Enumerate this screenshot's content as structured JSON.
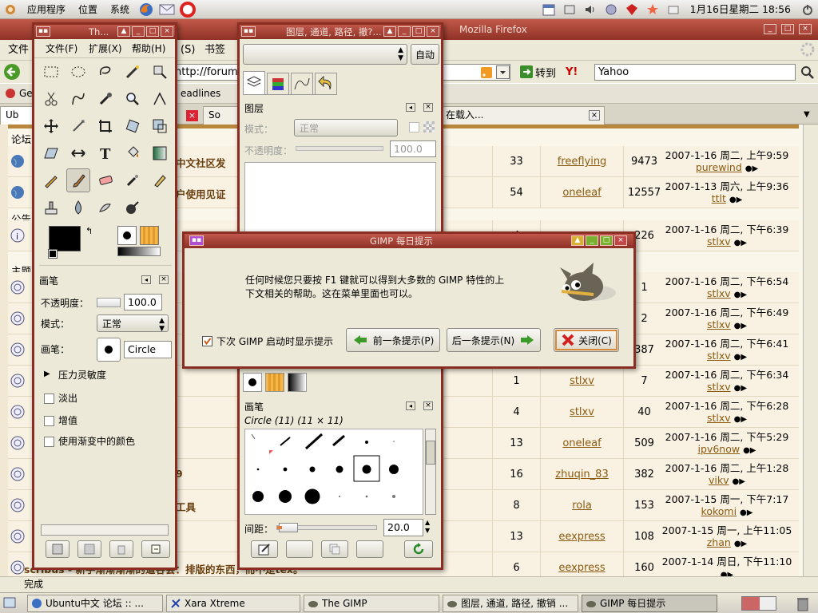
{
  "top_panel": {
    "menus": [
      "应用程序",
      "位置",
      "系统"
    ],
    "clock": "1月16日星期二 18:56"
  },
  "firefox": {
    "title_left": "Th...",
    "title_right": "Mozilla Firefox",
    "menu": [
      "文件",
      "(S)",
      "书签"
    ],
    "url": "http://forum.u",
    "go_label": "转到",
    "search_value": "Yahoo",
    "bookmarks": [
      "Ge",
      "eadlines"
    ],
    "tabs": [
      "Ub",
      "So",
      "在载入..."
    ],
    "status": "完成",
    "sidebar_labels": [
      "论坛",
      "公告",
      "主题"
    ],
    "rows": [
      {
        "title": "中文社区发",
        "replies": "33",
        "author": "freeflying",
        "views": "9473",
        "date": "2007-1-16 周二, 上午9:59",
        "last": "purewind"
      },
      {
        "title": "户使用见证",
        "replies": "54",
        "author": "oneleaf",
        "views": "12557",
        "date": "2007-1-13 周六, 上午9:36",
        "last": "ttlt"
      },
      {
        "title": "",
        "replies": "4",
        "author": "on",
        "views": "226",
        "date": "2007-1-16 周二, 下午6:39",
        "last": "stlxv"
      },
      {
        "title": "",
        "replies": "",
        "author": "",
        "views": "1",
        "date": "2007-1-16 周二, 下午6:54",
        "last": "stlxv"
      },
      {
        "title": "",
        "replies": "",
        "author": "",
        "views": "2",
        "date": "2007-1-16 周二, 下午6:49",
        "last": "stlxv"
      },
      {
        "title": "",
        "replies": "",
        "author": "",
        "views": "387",
        "date": "2007-1-16 周二, 下午6:41",
        "last": "stlxv"
      },
      {
        "title": "",
        "replies": "1",
        "author": "stlxv",
        "views": "7",
        "date": "2007-1-16 周二, 下午6:34",
        "last": "stlxv"
      },
      {
        "title": "",
        "replies": "4",
        "author": "stlxv",
        "views": "40",
        "date": "2007-1-16 周二, 下午6:28",
        "last": "stlxv"
      },
      {
        "title": "",
        "replies": "13",
        "author": "oneleaf",
        "views": "509",
        "date": "2007-1-16 周二, 下午5:29",
        "last": "ipv6now"
      },
      {
        "title": "9",
        "replies": "16",
        "author": "zhuqin_83",
        "views": "382",
        "date": "2007-1-16 周二, 上午1:28",
        "last": "vikv"
      },
      {
        "title": "工具",
        "replies": "8",
        "author": "rola",
        "views": "153",
        "date": "2007-1-15 周一, 下午7:17",
        "last": "kokomi"
      },
      {
        "title": "",
        "replies": "13",
        "author": "eexpress",
        "views": "108",
        "date": "2007-1-15 周一, 上午11:05",
        "last": "zhan"
      },
      {
        "title": "scribus - 新手渐渐渐渐的道谷会：排版的东西，而不是tex。",
        "replies": "6",
        "author": "eexpress",
        "views": "160",
        "date": "2007-1-14 周日, 下午11:10",
        "last": ""
      }
    ]
  },
  "toolbox": {
    "title": "Th...",
    "menu": [
      "文件(F)",
      "扩展(X)",
      "帮助(H)"
    ],
    "brush_panel": {
      "title": "画笔",
      "opacity_label": "不透明度：",
      "opacity_value": "100.0",
      "mode_label": "模式：",
      "mode_value": "正常",
      "brush_label": "画笔：",
      "brush_value": "Circle (1",
      "pressure": "压力灵敏度",
      "fade": "淡出",
      "increment": "增值",
      "gradient": "使用渐变中的颜色"
    }
  },
  "layers": {
    "title": "图层, 通道, 路径, 撤?...",
    "auto_button": "自动",
    "panel_title": "图层",
    "mode_label": "模式：",
    "mode_value": "正常",
    "opacity_label": "不透明度：",
    "opacity_value": "100.0",
    "brushes_title": "画笔",
    "brush_name": "Circle (11) (11 × 11)",
    "spacing_label": "间距：",
    "spacing_value": "20.0"
  },
  "tip_dialog": {
    "title": "GIMP 每日提示",
    "text": "任何时候您只要按 F1 键就可以得到大多数的 GIMP 特性的上下文相关的帮助。这在菜单里面也可以。",
    "checkbox_label": "下次 GIMP 启动时显示提示",
    "prev_button": "前一条提示(P)",
    "next_button": "后一条提示(N)",
    "close_button": "关闭(C)"
  },
  "taskbar": {
    "tasks": [
      "Ubuntu中文 论坛 :: ...",
      "Xara Xtreme",
      "The GIMP",
      "图层, 通道, 路径, 撤销 ...",
      "GIMP 每日提示"
    ]
  }
}
